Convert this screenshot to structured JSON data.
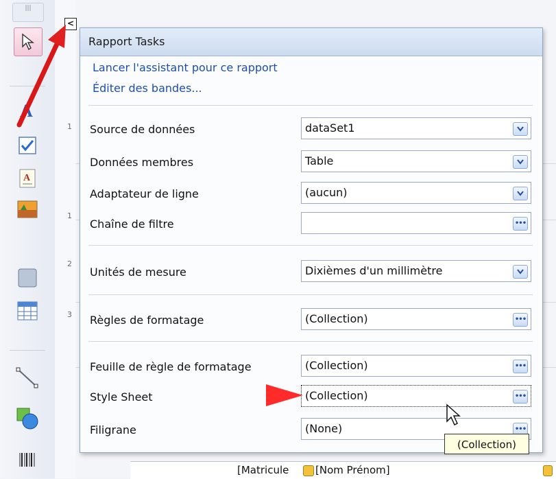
{
  "panel": {
    "title": "Rapport Tasks",
    "links": [
      "Lancer l'assistant pour ce rapport",
      "Éditer des bandes..."
    ],
    "properties": [
      {
        "label": "Source de données",
        "value": "dataSet1",
        "button": "dropdown"
      },
      {
        "label": "Données membres",
        "value": "Table",
        "button": "dropdown"
      },
      {
        "label": "Adaptateur de ligne",
        "value": "(aucun)",
        "button": "dropdown"
      },
      {
        "label": "Chaîne de filtre",
        "value": "",
        "button": "ellipsis"
      },
      {
        "label": "Unités de mesure",
        "value": "Dixièmes d'un millimètre",
        "button": "dropdown"
      },
      {
        "label": "Règles de formatage",
        "value": "(Collection)",
        "button": "ellipsis"
      },
      {
        "label": "Feuille de règle de formatage",
        "value": "(Collection)",
        "button": "ellipsis"
      },
      {
        "label": "Style Sheet",
        "value": "(Collection)",
        "button": "ellipsis"
      },
      {
        "label": "Filigrane",
        "value": "(None)",
        "button": "ellipsis"
      }
    ]
  },
  "tooltip": "(Collection)",
  "design_surface": {
    "ruler_numbers": [
      "1",
      "1",
      "2",
      "3"
    ],
    "bottom_fields": [
      "[Matricule",
      "[Nom Prénom]"
    ]
  },
  "annotation_color": "#e02020"
}
